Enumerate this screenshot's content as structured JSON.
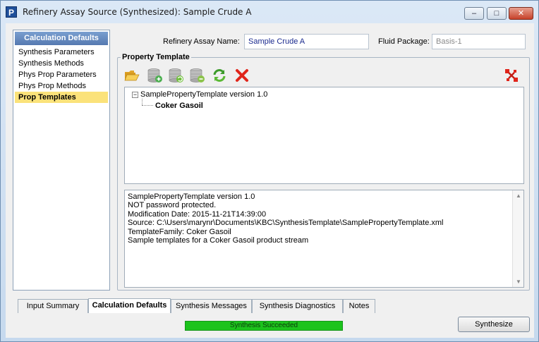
{
  "window": {
    "title": "Refinery Assay Source (Synthesized): Sample Crude A",
    "app_icon_letter": "P",
    "minimize_glyph": "–",
    "maximize_glyph": "□",
    "close_glyph": "✕"
  },
  "sidebar": {
    "header": "Calculation Defaults",
    "items": [
      {
        "label": "Synthesis Parameters",
        "selected": false
      },
      {
        "label": "Synthesis Methods",
        "selected": false
      },
      {
        "label": "Phys Prop Parameters",
        "selected": false
      },
      {
        "label": "Phys Prop Methods",
        "selected": false
      },
      {
        "label": "Prop Templates",
        "selected": true
      }
    ]
  },
  "header": {
    "assay_name_label": "Refinery Assay Name:",
    "assay_name_value": "Sample Crude A",
    "fluid_package_label": "Fluid Package:",
    "fluid_package_value": "Basis-1"
  },
  "property_template": {
    "group_title": "Property Template",
    "toolbar_icons": [
      "open-folder-icon",
      "add-database-icon",
      "refresh-database-icon",
      "delete-database-icon",
      "refresh-icon",
      "delete-icon",
      "disconnect-icon"
    ],
    "tree": {
      "root_expander": "−",
      "root_label": "SamplePropertyTemplate version 1.0",
      "child_label": "Coker Gasoil"
    },
    "info_lines": [
      "SamplePropertyTemplate version 1.0",
      "NOT password protected.",
      "Modification Date: 2015-11-21T14:39:00",
      "Source: C:\\Users\\marynr\\Documents\\KBC\\SynthesisTemplate\\SamplePropertyTemplate.xml",
      "TemplateFamily: Coker Gasoil",
      "Sample templates for a Coker Gasoil product stream"
    ]
  },
  "tabs": [
    {
      "label": "Input Summary",
      "active": false
    },
    {
      "label": "Calculation Defaults",
      "active": true
    },
    {
      "label": "Synthesis Messages",
      "active": false
    },
    {
      "label": "Synthesis Diagnostics",
      "active": false
    },
    {
      "label": "Notes",
      "active": false
    }
  ],
  "status": {
    "text": "Synthesis Succeeded",
    "color": "#1cc31c"
  },
  "actions": {
    "synthesize_label": "Synthesize"
  }
}
